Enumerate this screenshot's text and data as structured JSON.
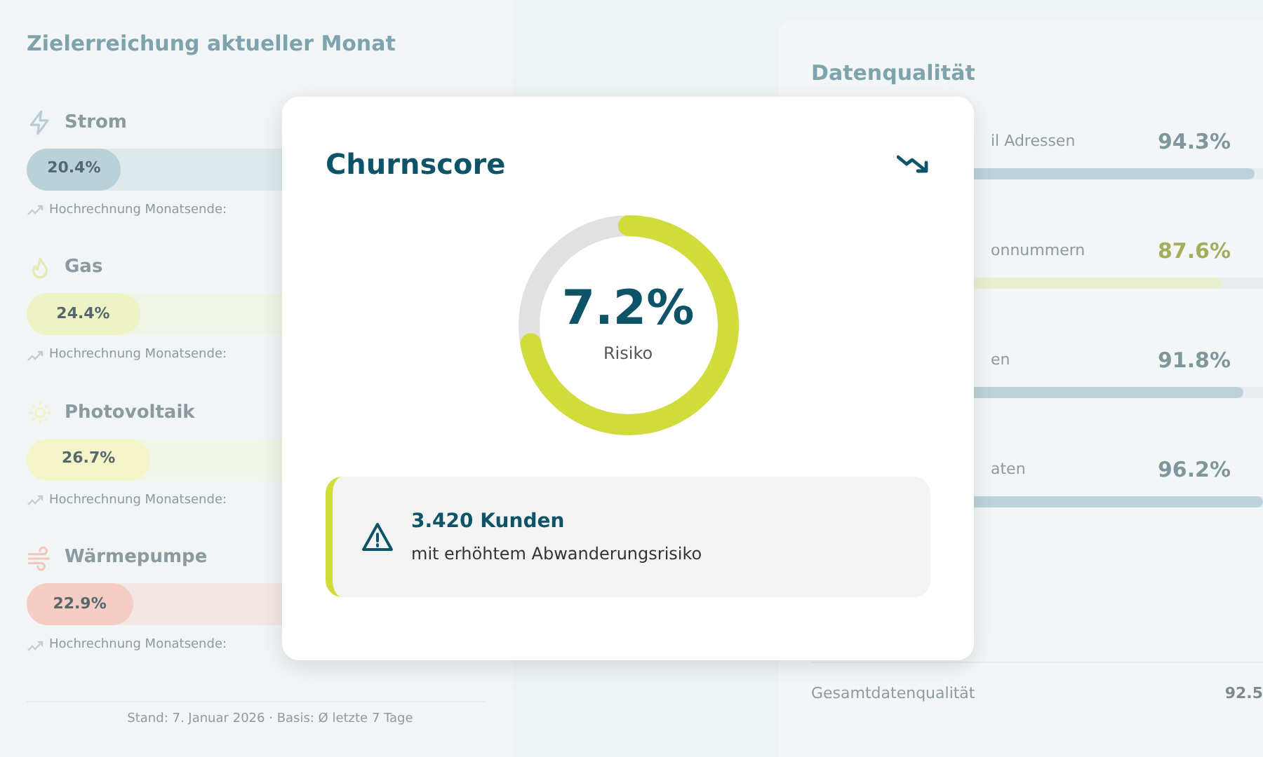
{
  "goals": {
    "title": "Zielerreichung aktueller Monat",
    "rows": [
      {
        "kind": "bolt",
        "label": "Strom",
        "reading": "20.4%",
        "level": 0.204,
        "color": "#b9d2d9",
        "projection": "Hochrechnung Monatsende:"
      },
      {
        "kind": "flame",
        "label": "Gas",
        "reading": "24.4%",
        "level": 0.244,
        "color": "#eef3c6",
        "projection": "Hochrechnung Monatsende:"
      },
      {
        "kind": "sun",
        "label": "Photovoltaik",
        "reading": "26.7%",
        "level": 0.267,
        "color": "#f3f5c9",
        "projection": "Hochrechnung Monatsende:"
      },
      {
        "kind": "wind",
        "label": "Wärmepumpe",
        "reading": "22.9%",
        "level": 0.229,
        "color": "#f5cdc4",
        "projection": "Hochrechnung Monatsende:"
      }
    ],
    "footer": "Stand: 7. Januar 2026 · Basis: Ø letzte 7 Tage"
  },
  "quality": {
    "title": "Datenqualität",
    "rows": [
      {
        "label": "il Adressen",
        "reading": "94.3%",
        "level": 0.943,
        "color": "#bcd3d9"
      },
      {
        "label": "onnummern",
        "reading": "87.6%",
        "level": 0.876,
        "color": "#eaf0cf"
      },
      {
        "label": "en",
        "reading": "91.8%",
        "level": 0.918,
        "color": "#bcd3d9"
      },
      {
        "label": "aten",
        "reading": "96.2%",
        "level": 0.962,
        "color": "#bcd3d9"
      }
    ],
    "total_label": "Gesamtdatenqualität",
    "total_value": "92.5"
  },
  "modal": {
    "title": "Churnscore",
    "value": "7.2%",
    "caption": "Risiko",
    "alert": {
      "title": "3.420 Kunden",
      "text": "mit erhöhtem Abwanderungsrisiko"
    }
  }
}
